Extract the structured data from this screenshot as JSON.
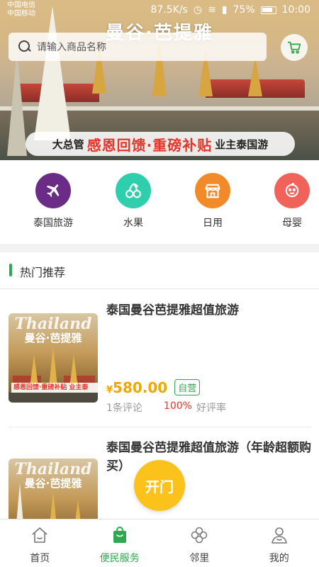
{
  "status_bar": {
    "carrier1": "中国电信",
    "carrier2": "中国移动",
    "speed": "87.5K/s",
    "battery": "75%",
    "time": "10:00"
  },
  "hero": {
    "city_title": "曼谷·芭提雅",
    "search_placeholder": "请输入商品名称",
    "promo_left": "大总管",
    "promo_highlight": "感恩回馈·重磅补贴",
    "promo_right": "业主泰国游"
  },
  "categories": [
    {
      "label": "泰国旅游",
      "icon": "airplane-icon",
      "color": "#6a2c86"
    },
    {
      "label": "水果",
      "icon": "cherry-icon",
      "color": "#2fcfae"
    },
    {
      "label": "日用",
      "icon": "shop-icon",
      "color": "#f28a2a"
    },
    {
      "label": "母婴",
      "icon": "baby-icon",
      "color": "#f0625a"
    }
  ],
  "section": {
    "title": "热门推荐"
  },
  "products": [
    {
      "title": "泰国曼谷芭提雅超值旅游",
      "currency": "¥",
      "price": "580.00",
      "badge": "自营",
      "reviews": "1条评论",
      "rate": "100%",
      "rate_label": "好评率",
      "thumb_word": "Thailand",
      "thumb_city": "曼谷·芭提雅",
      "thumb_promo": "感恩回馈·重磅补贴 业主泰"
    },
    {
      "title": "泰国曼谷芭提雅超值旅游（年龄超额购买）",
      "thumb_word": "Thailand",
      "thumb_city": "曼谷·芭提雅"
    }
  ],
  "fab": {
    "label": "开门"
  },
  "bottom_nav": [
    {
      "label": "首页",
      "icon": "home-icon"
    },
    {
      "label": "便民服务",
      "icon": "shopping-bag-icon",
      "active": true
    },
    {
      "label": "邻里",
      "icon": "clover-icon"
    },
    {
      "label": "我的",
      "icon": "user-icon"
    }
  ],
  "colors": {
    "accent_green": "#2fa84f",
    "price_yellow": "#f0a800",
    "fab_yellow": "#fbc21c",
    "promo_red": "#e5342a"
  }
}
